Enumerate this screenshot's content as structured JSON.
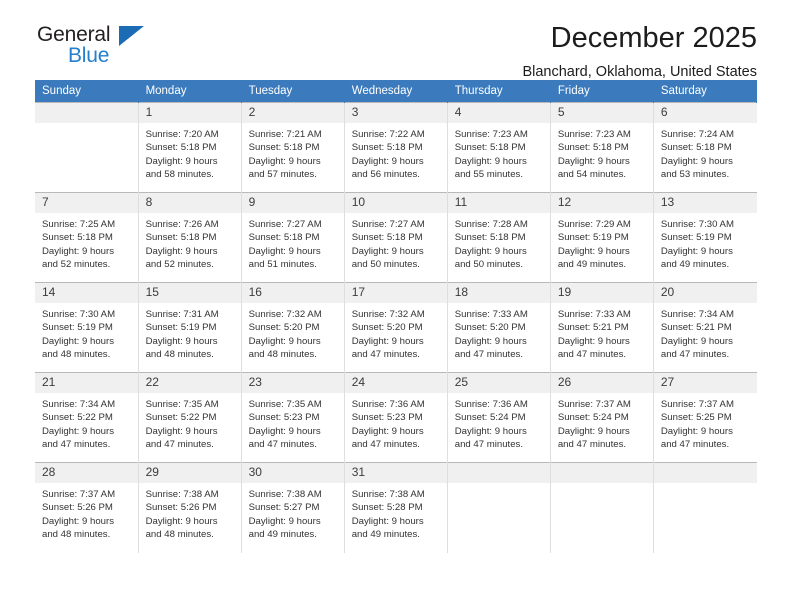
{
  "logo": {
    "word1": "General",
    "word2": "Blue",
    "triangle_color": "#1b6cb5",
    "blue_color": "#2480cd"
  },
  "header": {
    "title": "December 2025",
    "subtitle": "Blanchard, Oklahoma, United States",
    "header_bg": "#3a7abd"
  },
  "weekday_headers": [
    "Sunday",
    "Monday",
    "Tuesday",
    "Wednesday",
    "Thursday",
    "Friday",
    "Saturday"
  ],
  "labels": {
    "sunrise": "Sunrise:",
    "sunset": "Sunset:",
    "daylight": "Daylight:"
  },
  "weeks": [
    [
      {
        "day": "",
        "empty": true
      },
      {
        "day": "1",
        "sunrise": "Sunrise: 7:20 AM",
        "sunset": "Sunset: 5:18 PM",
        "daylight_1": "Daylight: 9 hours",
        "daylight_2": "and 58 minutes."
      },
      {
        "day": "2",
        "sunrise": "Sunrise: 7:21 AM",
        "sunset": "Sunset: 5:18 PM",
        "daylight_1": "Daylight: 9 hours",
        "daylight_2": "and 57 minutes."
      },
      {
        "day": "3",
        "sunrise": "Sunrise: 7:22 AM",
        "sunset": "Sunset: 5:18 PM",
        "daylight_1": "Daylight: 9 hours",
        "daylight_2": "and 56 minutes."
      },
      {
        "day": "4",
        "sunrise": "Sunrise: 7:23 AM",
        "sunset": "Sunset: 5:18 PM",
        "daylight_1": "Daylight: 9 hours",
        "daylight_2": "and 55 minutes."
      },
      {
        "day": "5",
        "sunrise": "Sunrise: 7:23 AM",
        "sunset": "Sunset: 5:18 PM",
        "daylight_1": "Daylight: 9 hours",
        "daylight_2": "and 54 minutes."
      },
      {
        "day": "6",
        "sunrise": "Sunrise: 7:24 AM",
        "sunset": "Sunset: 5:18 PM",
        "daylight_1": "Daylight: 9 hours",
        "daylight_2": "and 53 minutes."
      }
    ],
    [
      {
        "day": "7",
        "sunrise": "Sunrise: 7:25 AM",
        "sunset": "Sunset: 5:18 PM",
        "daylight_1": "Daylight: 9 hours",
        "daylight_2": "and 52 minutes."
      },
      {
        "day": "8",
        "sunrise": "Sunrise: 7:26 AM",
        "sunset": "Sunset: 5:18 PM",
        "daylight_1": "Daylight: 9 hours",
        "daylight_2": "and 52 minutes."
      },
      {
        "day": "9",
        "sunrise": "Sunrise: 7:27 AM",
        "sunset": "Sunset: 5:18 PM",
        "daylight_1": "Daylight: 9 hours",
        "daylight_2": "and 51 minutes."
      },
      {
        "day": "10",
        "sunrise": "Sunrise: 7:27 AM",
        "sunset": "Sunset: 5:18 PM",
        "daylight_1": "Daylight: 9 hours",
        "daylight_2": "and 50 minutes."
      },
      {
        "day": "11",
        "sunrise": "Sunrise: 7:28 AM",
        "sunset": "Sunset: 5:18 PM",
        "daylight_1": "Daylight: 9 hours",
        "daylight_2": "and 50 minutes."
      },
      {
        "day": "12",
        "sunrise": "Sunrise: 7:29 AM",
        "sunset": "Sunset: 5:19 PM",
        "daylight_1": "Daylight: 9 hours",
        "daylight_2": "and 49 minutes."
      },
      {
        "day": "13",
        "sunrise": "Sunrise: 7:30 AM",
        "sunset": "Sunset: 5:19 PM",
        "daylight_1": "Daylight: 9 hours",
        "daylight_2": "and 49 minutes."
      }
    ],
    [
      {
        "day": "14",
        "sunrise": "Sunrise: 7:30 AM",
        "sunset": "Sunset: 5:19 PM",
        "daylight_1": "Daylight: 9 hours",
        "daylight_2": "and 48 minutes."
      },
      {
        "day": "15",
        "sunrise": "Sunrise: 7:31 AM",
        "sunset": "Sunset: 5:19 PM",
        "daylight_1": "Daylight: 9 hours",
        "daylight_2": "and 48 minutes."
      },
      {
        "day": "16",
        "sunrise": "Sunrise: 7:32 AM",
        "sunset": "Sunset: 5:20 PM",
        "daylight_1": "Daylight: 9 hours",
        "daylight_2": "and 48 minutes."
      },
      {
        "day": "17",
        "sunrise": "Sunrise: 7:32 AM",
        "sunset": "Sunset: 5:20 PM",
        "daylight_1": "Daylight: 9 hours",
        "daylight_2": "and 47 minutes."
      },
      {
        "day": "18",
        "sunrise": "Sunrise: 7:33 AM",
        "sunset": "Sunset: 5:20 PM",
        "daylight_1": "Daylight: 9 hours",
        "daylight_2": "and 47 minutes."
      },
      {
        "day": "19",
        "sunrise": "Sunrise: 7:33 AM",
        "sunset": "Sunset: 5:21 PM",
        "daylight_1": "Daylight: 9 hours",
        "daylight_2": "and 47 minutes."
      },
      {
        "day": "20",
        "sunrise": "Sunrise: 7:34 AM",
        "sunset": "Sunset: 5:21 PM",
        "daylight_1": "Daylight: 9 hours",
        "daylight_2": "and 47 minutes."
      }
    ],
    [
      {
        "day": "21",
        "sunrise": "Sunrise: 7:34 AM",
        "sunset": "Sunset: 5:22 PM",
        "daylight_1": "Daylight: 9 hours",
        "daylight_2": "and 47 minutes."
      },
      {
        "day": "22",
        "sunrise": "Sunrise: 7:35 AM",
        "sunset": "Sunset: 5:22 PM",
        "daylight_1": "Daylight: 9 hours",
        "daylight_2": "and 47 minutes."
      },
      {
        "day": "23",
        "sunrise": "Sunrise: 7:35 AM",
        "sunset": "Sunset: 5:23 PM",
        "daylight_1": "Daylight: 9 hours",
        "daylight_2": "and 47 minutes."
      },
      {
        "day": "24",
        "sunrise": "Sunrise: 7:36 AM",
        "sunset": "Sunset: 5:23 PM",
        "daylight_1": "Daylight: 9 hours",
        "daylight_2": "and 47 minutes."
      },
      {
        "day": "25",
        "sunrise": "Sunrise: 7:36 AM",
        "sunset": "Sunset: 5:24 PM",
        "daylight_1": "Daylight: 9 hours",
        "daylight_2": "and 47 minutes."
      },
      {
        "day": "26",
        "sunrise": "Sunrise: 7:37 AM",
        "sunset": "Sunset: 5:24 PM",
        "daylight_1": "Daylight: 9 hours",
        "daylight_2": "and 47 minutes."
      },
      {
        "day": "27",
        "sunrise": "Sunrise: 7:37 AM",
        "sunset": "Sunset: 5:25 PM",
        "daylight_1": "Daylight: 9 hours",
        "daylight_2": "and 47 minutes."
      }
    ],
    [
      {
        "day": "28",
        "sunrise": "Sunrise: 7:37 AM",
        "sunset": "Sunset: 5:26 PM",
        "daylight_1": "Daylight: 9 hours",
        "daylight_2": "and 48 minutes."
      },
      {
        "day": "29",
        "sunrise": "Sunrise: 7:38 AM",
        "sunset": "Sunset: 5:26 PM",
        "daylight_1": "Daylight: 9 hours",
        "daylight_2": "and 48 minutes."
      },
      {
        "day": "30",
        "sunrise": "Sunrise: 7:38 AM",
        "sunset": "Sunset: 5:27 PM",
        "daylight_1": "Daylight: 9 hours",
        "daylight_2": "and 49 minutes."
      },
      {
        "day": "31",
        "sunrise": "Sunrise: 7:38 AM",
        "sunset": "Sunset: 5:28 PM",
        "daylight_1": "Daylight: 9 hours",
        "daylight_2": "and 49 minutes."
      },
      {
        "day": "",
        "empty": true
      },
      {
        "day": "",
        "empty": true
      },
      {
        "day": "",
        "empty": true
      }
    ]
  ]
}
